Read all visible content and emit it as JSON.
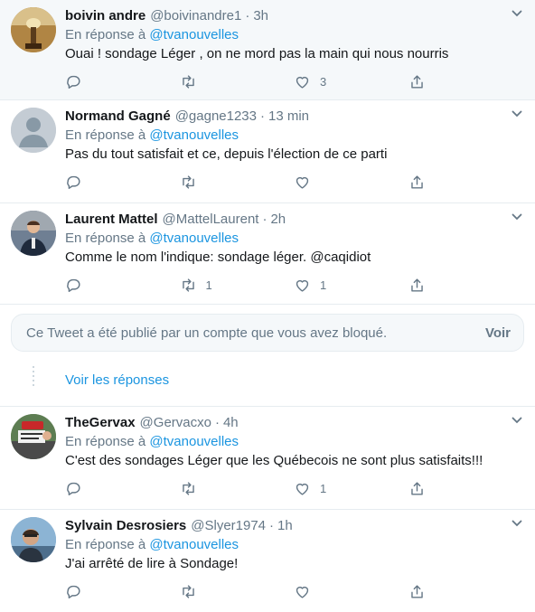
{
  "tweets": [
    {
      "name": "boivin andre",
      "handle": "@boivinandre1",
      "sep": "·",
      "time": "3h",
      "reply_prefix": "En réponse à",
      "reply_to": "@tvanouvelles",
      "text": "Ouai ! sondage Léger , on ne mord pas la main qui nous nourris",
      "replies": "",
      "retweets": "",
      "likes": "3",
      "highlight": true
    },
    {
      "name": "Normand Gagné",
      "handle": "@gagne1233",
      "sep": "·",
      "time": "13 min",
      "reply_prefix": "En réponse à",
      "reply_to": "@tvanouvelles",
      "text": "Pas du tout satisfait et ce, depuis l'élection de ce parti",
      "replies": "",
      "retweets": "",
      "likes": "",
      "highlight": false
    },
    {
      "name": "Laurent Mattel",
      "handle": "@MattelLaurent",
      "sep": "·",
      "time": "2h",
      "reply_prefix": "En réponse à",
      "reply_to": "@tvanouvelles",
      "text": "Comme le nom l'indique: sondage léger. @caqidiot",
      "replies": "",
      "retweets": "1",
      "likes": "1",
      "highlight": false
    },
    {
      "name": "TheGervax",
      "handle": "@Gervacxo",
      "sep": "·",
      "time": "4h",
      "reply_prefix": "En réponse à",
      "reply_to": "@tvanouvelles",
      "text": "C'est des sondages Léger que les Québecois ne sont plus satisfaits!!!",
      "replies": "",
      "retweets": "",
      "likes": "1",
      "highlight": false
    },
    {
      "name": "Sylvain Desrosiers",
      "handle": "@Slyer1974",
      "sep": "·",
      "time": "1h",
      "reply_prefix": "En réponse à",
      "reply_to": "@tvanouvelles",
      "text": "J'ai arrêté de lire à Sondage!",
      "replies": "",
      "retweets": "",
      "likes": "",
      "highlight": false
    }
  ],
  "blocked": {
    "text": "Ce Tweet a été publié par un compte que vous avez bloqué.",
    "action": "Voir"
  },
  "show_replies": "Voir les réponses",
  "icons": {
    "reply": "reply-icon",
    "retweet": "retweet-icon",
    "like": "heart-icon",
    "share": "share-icon",
    "caret": "chevron-down-icon"
  },
  "colors": {
    "link": "#1b95e0",
    "muted": "#657786",
    "text": "#14171a",
    "border": "#e6ecf0",
    "highlight_bg": "#f5f8fa"
  }
}
